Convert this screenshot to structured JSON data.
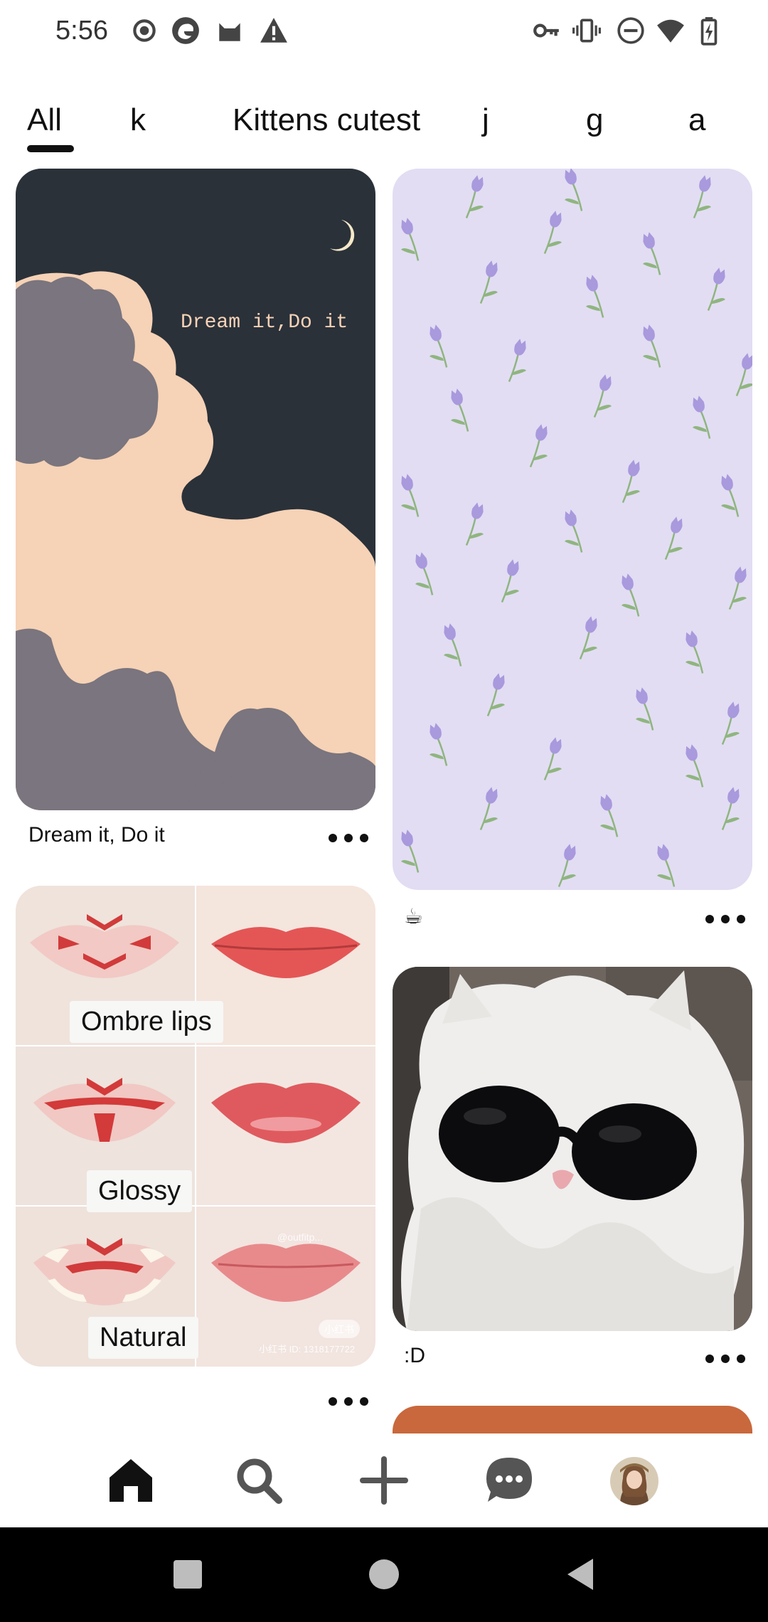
{
  "status_bar": {
    "time": "5:56",
    "left_icons": [
      "record-icon",
      "edge-browser-icon",
      "cat-app-icon",
      "warning-icon"
    ],
    "right_icons": [
      "key-icon",
      "vibrate-icon",
      "do-not-disturb-icon",
      "wifi-icon",
      "battery-charging-icon"
    ]
  },
  "tabs": [
    {
      "label": "All",
      "selected": true
    },
    {
      "label": "k",
      "selected": false
    },
    {
      "label": "Kittens cutest",
      "selected": false
    },
    {
      "label": "j",
      "selected": false
    },
    {
      "label": "g",
      "selected": false
    },
    {
      "label": "a",
      "selected": false
    }
  ],
  "pins": {
    "dream": {
      "image_text": "Dream it,Do it",
      "title": "Dream it, Do it"
    },
    "tulips": {
      "title": "☕"
    },
    "lips": {
      "labels": [
        "Ombre lips",
        "Glossy",
        "Natural"
      ],
      "watermark": "@outfitp...",
      "brand": "小红书",
      "id_text": "小红书 ID: 1318177722"
    },
    "cat": {
      "title": ":D"
    }
  },
  "bottom_nav": {
    "items": [
      "home-icon",
      "search-icon",
      "create-icon",
      "messages-icon",
      "profile-avatar"
    ]
  },
  "colors": {
    "dream_bg": "#2a3139",
    "dream_cloud_peach": "#f6d2b6",
    "dream_cloud_gray": "#7a757e",
    "tulip_bg": "#e2ddf3",
    "tulip_flower": "#a999dd",
    "tulip_stem": "#8fb57f"
  }
}
